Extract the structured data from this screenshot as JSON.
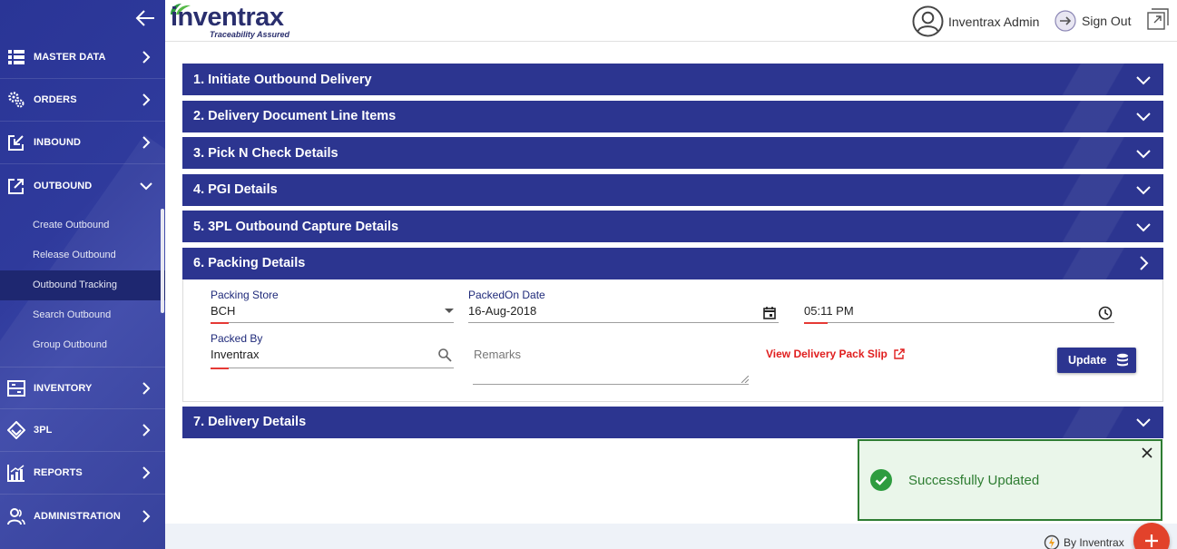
{
  "app": {
    "brand": "inventrax",
    "tagline": "Traceability Assured"
  },
  "header": {
    "user_name": "Inventrax Admin",
    "sign_out": "Sign Out"
  },
  "sidebar": {
    "items": [
      {
        "label": "MASTER DATA",
        "icon": "list-icon"
      },
      {
        "label": "ORDERS",
        "icon": "gears-icon"
      },
      {
        "label": "INBOUND",
        "icon": "inbound-icon"
      },
      {
        "label": "OUTBOUND",
        "icon": "outbound-icon",
        "expanded": true
      },
      {
        "label": "INVENTORY",
        "icon": "inventory-icon"
      },
      {
        "label": "3PL",
        "icon": "3pl-icon"
      },
      {
        "label": "REPORTS",
        "icon": "reports-icon"
      },
      {
        "label": "ADMINISTRATION",
        "icon": "users-icon"
      }
    ],
    "outbound_sub": [
      "Create Outbound",
      "Release Outbound",
      "Outbound Tracking",
      "Search Outbound",
      "Group Outbound"
    ],
    "active_sub": "Outbound Tracking"
  },
  "sections": [
    {
      "title": "1. Initiate Outbound Delivery"
    },
    {
      "title": "2. Delivery Document Line Items"
    },
    {
      "title": "3. Pick N Check Details"
    },
    {
      "title": "4. PGI Details"
    },
    {
      "title": "5. 3PL Outbound Capture Details"
    },
    {
      "title": "6. Packing Details",
      "expanded": true
    },
    {
      "title": "7. Delivery Details"
    }
  ],
  "packing": {
    "store_label": "Packing Store",
    "store_value": "BCH",
    "date_label": "PackedOn Date",
    "date_value": "16-Aug-2018",
    "time_value": "05:11 PM",
    "packed_by_label": "Packed By",
    "packed_by_value": "Inventrax",
    "remarks_placeholder": "Remarks",
    "pack_slip_link": "View Delivery Pack Slip",
    "update_button": "Update"
  },
  "toast": {
    "message": "Successfully Updated"
  },
  "footer": {
    "brand": "By Inventrax"
  },
  "colors": {
    "primary": "#2c3590",
    "accent_red": "#e53935",
    "success": "#2e7d32"
  }
}
